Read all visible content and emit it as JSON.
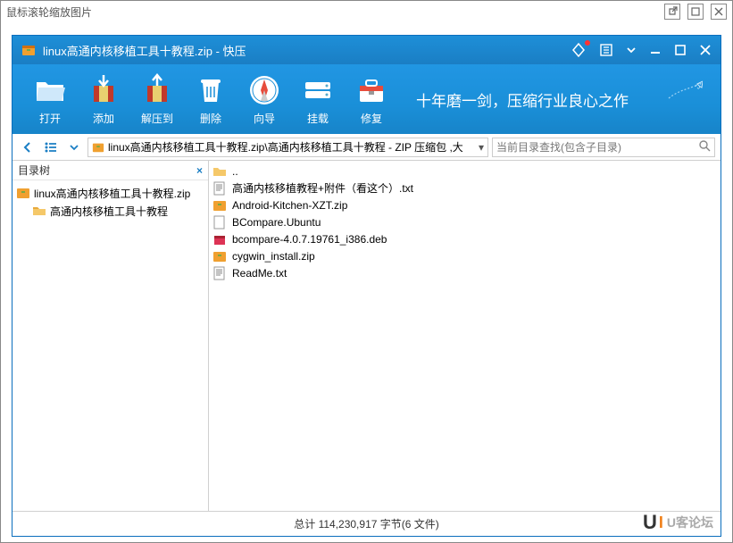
{
  "outer": {
    "title": "鼠标滚轮缩放图片"
  },
  "app": {
    "title": "linux高通内核移植工具十教程.zip - 快压"
  },
  "toolbar": {
    "open": "打开",
    "add": "添加",
    "extract": "解压到",
    "delete": "删除",
    "wizard": "向导",
    "mount": "挂载",
    "repair": "修复",
    "slogan": "十年磨一剑，压缩行业良心之作"
  },
  "nav": {
    "path": "linux高通内核移植工具十教程.zip\\高通内核移植工具十教程 - ZIP 压缩包 ,大",
    "search_placeholder": "当前目录查找(包含子目录)"
  },
  "sidebar": {
    "title": "目录树",
    "root": "linux高通内核移植工具十教程.zip",
    "folder": "高通内核移植工具十教程"
  },
  "files": {
    "up": "..",
    "items": [
      {
        "name": "高通内核移植教程+附件（看这个）.txt",
        "type": "txt"
      },
      {
        "name": "Android-Kitchen-XZT.zip",
        "type": "zip"
      },
      {
        "name": "BCompare.Ubuntu",
        "type": "file"
      },
      {
        "name": "bcompare-4.0.7.19761_i386.deb",
        "type": "deb"
      },
      {
        "name": "cygwin_install.zip",
        "type": "zip"
      },
      {
        "name": "ReadMe.txt",
        "type": "txt"
      }
    ]
  },
  "status": {
    "text": "总计  114,230,917 字节(6 文件)"
  },
  "watermark": {
    "text": "U客论坛"
  }
}
